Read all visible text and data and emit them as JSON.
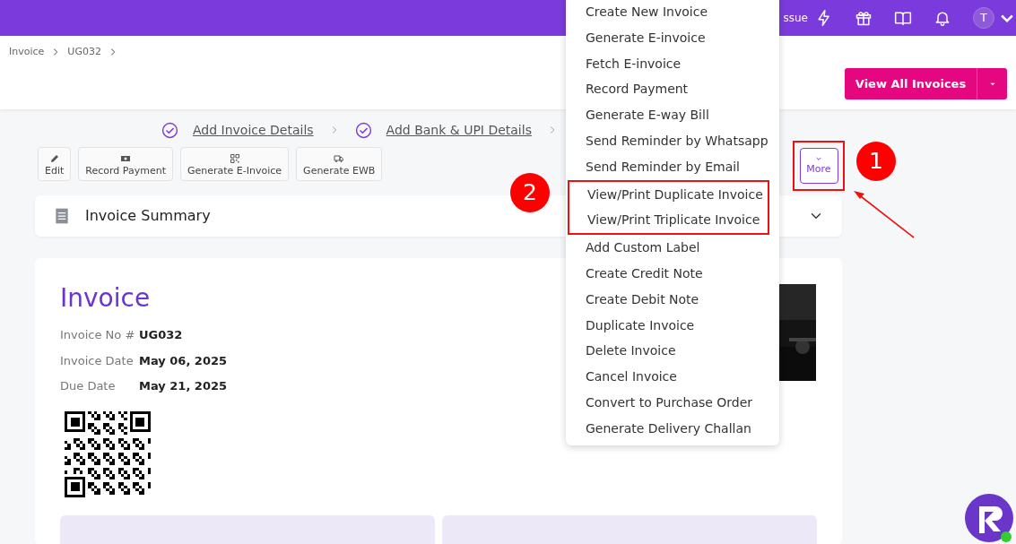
{
  "top_bar": {
    "cut_text": "ssue",
    "avatar": "T"
  },
  "breadcrumb": [
    "Invoice",
    "UG032"
  ],
  "view_all_button": "View All Invoices",
  "steps": [
    {
      "label": "Add Invoice Details",
      "done": true
    },
    {
      "label": "Add Bank & UPI Details",
      "done": true
    }
  ],
  "toolbar": [
    {
      "label": "Edit",
      "kind": "pencil"
    },
    {
      "label": "Record Payment",
      "kind": "cash"
    },
    {
      "label": "Generate E-Invoice",
      "kind": "qr"
    },
    {
      "label": "Generate EWB",
      "kind": "truck"
    }
  ],
  "more_button": "More",
  "summary": {
    "title": "Invoice Summary",
    "expanded": false
  },
  "invoice": {
    "title": "Invoice",
    "fields": [
      {
        "label": "Invoice No #",
        "value": "UG032"
      },
      {
        "label": "Invoice Date",
        "value": "May 06, 2025"
      },
      {
        "label": "Due Date",
        "value": "May 21, 2025"
      }
    ]
  },
  "menu": [
    {
      "label": "Create New Invoice",
      "boxed": false
    },
    {
      "label": "Generate E-invoice",
      "boxed": false
    },
    {
      "label": "Fetch E-invoice",
      "boxed": false
    },
    {
      "label": "Record Payment",
      "boxed": false
    },
    {
      "label": "Generate E-way Bill",
      "boxed": false
    },
    {
      "label": "Send Reminder by Whatsapp",
      "boxed": false
    },
    {
      "label": "Send Reminder by Email",
      "boxed": false
    },
    {
      "label": "View/Print Duplicate Invoice",
      "boxed": true
    },
    {
      "label": "View/Print Triplicate Invoice",
      "boxed": true
    },
    {
      "label": "Add Custom Label",
      "boxed": false
    },
    {
      "label": "Create Credit Note",
      "boxed": false
    },
    {
      "label": "Create Debit Note",
      "boxed": false
    },
    {
      "label": "Duplicate Invoice",
      "boxed": false
    },
    {
      "label": "Delete Invoice",
      "boxed": false
    },
    {
      "label": "Cancel Invoice",
      "boxed": false
    },
    {
      "label": "Convert to Purchase Order",
      "boxed": false
    },
    {
      "label": "Generate Delivery Challan",
      "boxed": false
    }
  ],
  "annotations": [
    {
      "number": "1"
    },
    {
      "number": "2"
    }
  ]
}
